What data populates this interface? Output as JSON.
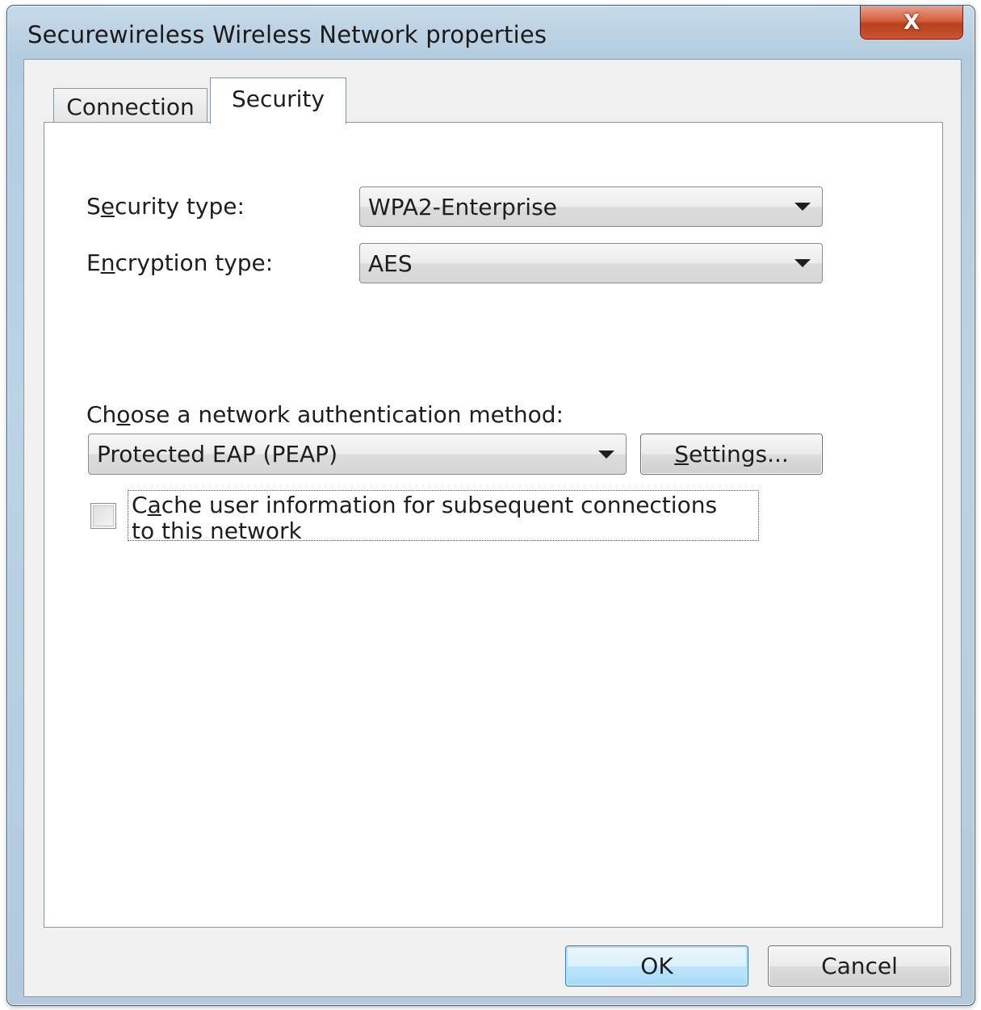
{
  "window": {
    "title": "Securewireless Wireless Network properties",
    "close_glyph": "X"
  },
  "tabs": [
    {
      "label": "Connection",
      "selected": false
    },
    {
      "label": "Security",
      "selected": true
    }
  ],
  "security": {
    "security_type": {
      "label_pre": "S",
      "label_u": "e",
      "label_post": "curity type:",
      "value": "WPA2-Enterprise"
    },
    "encryption_type": {
      "label_pre": "E",
      "label_u": "n",
      "label_post": "cryption type:",
      "value": "AES"
    },
    "auth": {
      "label_pre": "Ch",
      "label_u": "o",
      "label_post": "ose a network authentication method:",
      "value": "Protected EAP (PEAP)",
      "settings_pre": "",
      "settings_u": "S",
      "settings_post": "ettings..."
    },
    "cache": {
      "checked": false,
      "line1_pre": "C",
      "line1_u": "a",
      "line1_post": "che user information for subsequent connections",
      "line2": "to this network"
    }
  },
  "buttons": {
    "ok": "OK",
    "cancel": "Cancel"
  },
  "colors": {
    "frame": "#b4cce0",
    "close": "#c9552f",
    "default_button": "#bee6fd"
  },
  "icons": [
    "close-icon",
    "dropdown-arrow-icon"
  ]
}
